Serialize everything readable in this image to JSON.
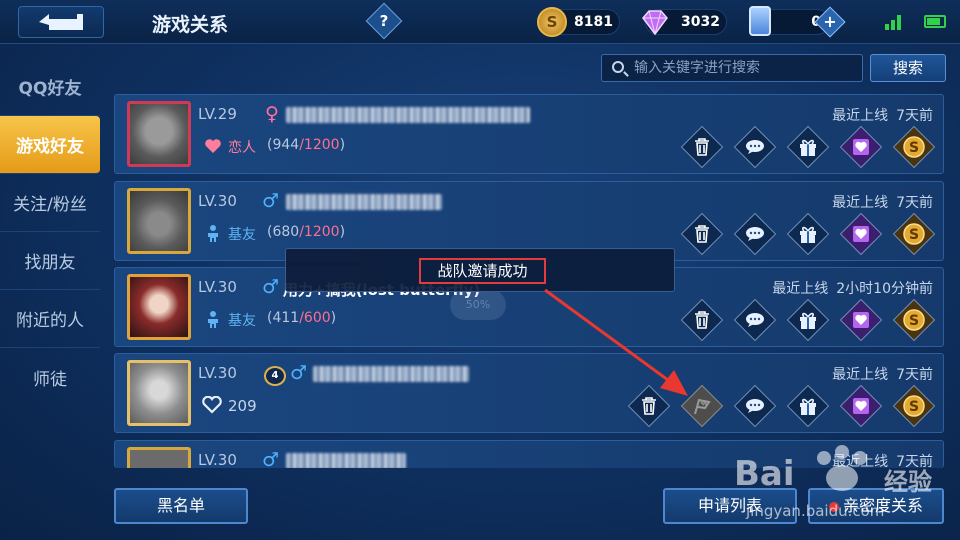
{
  "header": {
    "title": "游戏关系",
    "help": "?",
    "coins": "8181",
    "diamonds": "3032",
    "vouchers": "0",
    "plus": "+"
  },
  "sidebar": {
    "items": [
      {
        "label": "QQ好友"
      },
      {
        "label": "游戏好友"
      },
      {
        "label": "关注/粉丝"
      },
      {
        "label": "找朋友"
      },
      {
        "label": "附近的人"
      },
      {
        "label": "师徒"
      }
    ]
  },
  "search": {
    "placeholder": "输入关键字进行搜索",
    "button": "搜索"
  },
  "friends": [
    {
      "level": "LV.29",
      "relation": "恋人",
      "intimacy": "944",
      "intimacy_max": "/1200",
      "online_label": "最近上线",
      "online_time": "7天前"
    },
    {
      "level": "LV.30",
      "relation": "基友",
      "intimacy": "680",
      "intimacy_max": "/1200",
      "online_label": "最近上线",
      "online_time": "7天前"
    },
    {
      "level": "LV.30",
      "name": "用力+搞我(lost butterfly)",
      "relation": "基友",
      "intimacy": "411",
      "intimacy_max": "/600",
      "online_label": "最近上线",
      "online_time": "2小时10分钟前",
      "faded_badge": "50%"
    },
    {
      "level": "LV.30",
      "rank_badge": "4",
      "likes": "209",
      "online_label": "最近上线",
      "online_time": "7天前"
    },
    {
      "level": "LV.30",
      "online_label": "最近上线",
      "online_time": "7天前"
    }
  ],
  "toast": {
    "text": "战队邀请成功"
  },
  "footer": {
    "blacklist": "黑名单",
    "requests": "申请列表",
    "intimate": "亲密度关系"
  },
  "watermark": {
    "brand": "Bai",
    "brand2": "经验",
    "url": "jingyan.baidu.com"
  },
  "colors": {
    "accent_gold": "#f6c54a",
    "alert_red": "#e43b3b",
    "arrow_red": "#e8382f"
  }
}
